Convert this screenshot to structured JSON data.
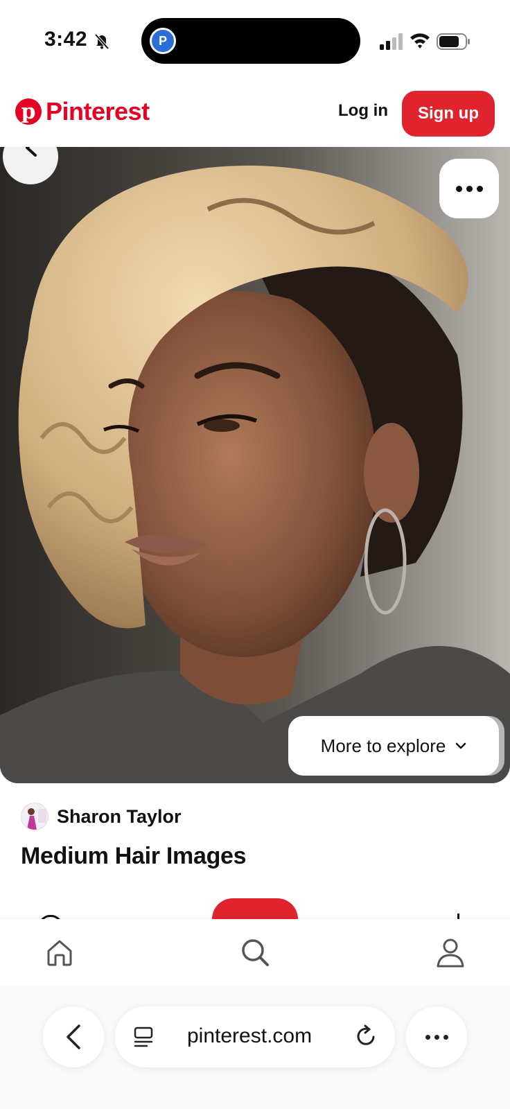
{
  "status_bar": {
    "time": "3:42",
    "island_app_letter": "P",
    "icons": [
      "bell-off-icon",
      "cellular-signal-icon",
      "wifi-icon",
      "battery-icon"
    ]
  },
  "header": {
    "brand": "Pinterest",
    "brand_color": "#e60023",
    "login_label": "Log in",
    "signup_label": "Sign up",
    "signup_color": "#e0242d"
  },
  "pin": {
    "image_subject": "pin-photo",
    "more_to_explore_label": "More to explore",
    "creator_name": "Sharon Taylor",
    "title": "Medium Hair Images"
  },
  "bottom_nav": {
    "items": [
      "home-icon",
      "search-icon",
      "profile-icon"
    ]
  },
  "browser": {
    "url": "pinterest.com",
    "icons": [
      "back-icon",
      "tab-overview-icon",
      "reload-icon",
      "more-icon"
    ]
  }
}
